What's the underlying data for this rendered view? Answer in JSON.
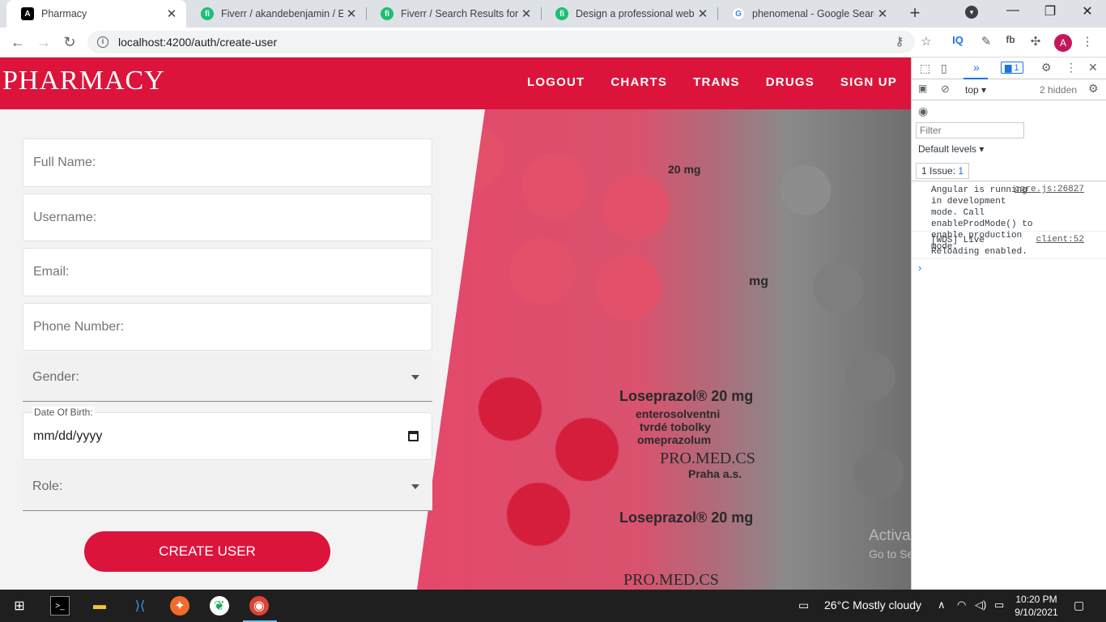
{
  "browser": {
    "tabs": [
      {
        "title": "Pharmacy",
        "favicon": "angular-icon",
        "active": true
      },
      {
        "title": "Fiverr / akandebenjamin / Edi",
        "favicon": "fiverr-icon"
      },
      {
        "title": "Fiverr / Search Results for 'gu",
        "favicon": "fiverr-icon"
      },
      {
        "title": "Design a professional website",
        "favicon": "fiverr-icon"
      },
      {
        "title": "phenomenal - Google Search",
        "favicon": "google-icon"
      }
    ],
    "url": "localhost:4200/auth/create-user"
  },
  "app": {
    "brand": "PHARMACY",
    "nav": [
      "LOGOUT",
      "CHARTS",
      "TRANS",
      "DRUGS",
      "SIGN UP"
    ],
    "accent": "#dc143c"
  },
  "form": {
    "full_name_placeholder": "Full Name:",
    "username_placeholder": "Username:",
    "email_placeholder": "Email:",
    "phone_placeholder": "Phone Number:",
    "gender_placeholder": "Gender:",
    "dob_label": "Date Of Birth:",
    "dob_value": "mm/dd/yyyy",
    "role_placeholder": "Role:",
    "submit_label": "CREATE USER"
  },
  "hero_text": {
    "mg1": "20 mg",
    "mg2": "mg",
    "brand1": "Loseprazol® 20 mg",
    "brand2": "Loseprazol® 20 mg",
    "line1": "enterosolventni",
    "line2": "tvrdé tobolky",
    "line3": "omeprazolum",
    "maker": "PRO.MED.CS",
    "city": "Praha a.s."
  },
  "watermark": {
    "title": "Activate Windows",
    "subtitle": "Go to Settings to activate Windows."
  },
  "devtools": {
    "context": "top",
    "hidden": "2 hidden",
    "filter_placeholder": "Filter",
    "levels": "Default levels",
    "issues": "1 Issue:",
    "issues_count": "1",
    "tab_badge": "1",
    "messages": [
      {
        "text": "Angular is running in development mode. Call enableProdMode() to enable production mode.",
        "source": "core.js:26827"
      },
      {
        "text": "[WDS] Live Reloading enabled.",
        "source": "client:52"
      }
    ]
  },
  "taskbar": {
    "weather": "26°C  Mostly cloudy",
    "time": "10:20 PM",
    "date": "9/10/2021"
  }
}
